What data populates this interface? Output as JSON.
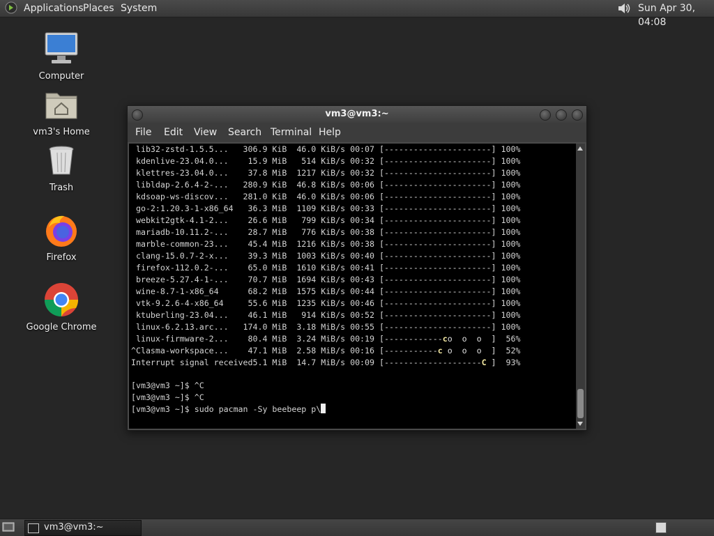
{
  "top_panel": {
    "menus": [
      "Applications",
      "Places",
      "System"
    ],
    "clock": "Sun Apr 30, 04:08",
    "icons": {
      "logo": "gnome-foot-icon",
      "volume": "speaker-icon"
    }
  },
  "desktop": {
    "icons": [
      {
        "label": "Computer",
        "icon": "computer-monitor-icon"
      },
      {
        "label": "vm3's Home",
        "icon": "home-folder-icon"
      },
      {
        "label": "Trash",
        "icon": "trash-can-icon"
      },
      {
        "label": "Firefox",
        "icon": "firefox-icon"
      },
      {
        "label": "Google Chrome",
        "icon": "chrome-icon"
      }
    ]
  },
  "terminal": {
    "title": "vm3@vm3:~",
    "menu": [
      "File",
      "Edit",
      "View",
      "Search",
      "Terminal",
      "Help"
    ],
    "lines": [
      " lib32-zstd-1.5.5...   306.9 KiB  46.0 KiB/s 00:07 [----------------------] 100%",
      " kdenlive-23.04.0...    15.9 MiB   514 KiB/s 00:32 [----------------------] 100%",
      " klettres-23.04.0...    37.8 MiB  1217 KiB/s 00:32 [----------------------] 100%",
      " libldap-2.6.4-2-...   280.9 KiB  46.8 KiB/s 00:06 [----------------------] 100%",
      " kdsoap-ws-discov...   281.0 KiB  46.0 KiB/s 00:06 [----------------------] 100%",
      " go-2:1.20.3-1-x86_64   36.3 MiB  1109 KiB/s 00:33 [----------------------] 100%",
      " webkit2gtk-4.1-2...    26.6 MiB   799 KiB/s 00:34 [----------------------] 100%",
      " mariadb-10.11.2-...    28.7 MiB   776 KiB/s 00:38 [----------------------] 100%",
      " marble-common-23...    45.4 MiB  1216 KiB/s 00:38 [----------------------] 100%",
      " clang-15.0.7-2-x...    39.3 MiB  1003 KiB/s 00:40 [----------------------] 100%",
      " firefox-112.0.2-...    65.0 MiB  1610 KiB/s 00:41 [----------------------] 100%",
      " breeze-5.27.4-1-...    70.7 MiB  1694 KiB/s 00:43 [----------------------] 100%",
      " wine-8.7-1-x86_64      68.2 MiB  1575 KiB/s 00:44 [----------------------] 100%",
      " vtk-9.2.6-4-x86_64     55.6 MiB  1235 KiB/s 00:46 [----------------------] 100%",
      " ktuberling-23.04...    46.1 MiB   914 KiB/s 00:52 [----------------------] 100%",
      " linux-6.2.13.arc...   174.0 MiB  3.18 MiB/s 00:55 [----------------------] 100%"
    ],
    "progress_lines": [
      {
        "pre": " linux-firmware-2...    80.4 MiB  3.24 MiB/s 00:19 [------------",
        "pac": "c",
        "pills": "o  o  o  ]",
        "pct": "  56%"
      },
      {
        "pre": "^Clasma-workspace...    47.1 MiB  2.58 MiB/s 00:16 [-----------",
        "pac": "c",
        "pills": " o  o  o  ]",
        "pct": "  52%"
      },
      {
        "pre": "Interrupt signal received5.1 MiB  14.7 MiB/s 00:09 [--------------------",
        "pac": "C",
        "pills": " ]",
        "pct": "  93%"
      }
    ],
    "prompt_lines": [
      "[vm3@vm3 ~]$ ^C",
      "[vm3@vm3 ~]$ ^C"
    ],
    "current_command": "[vm3@vm3 ~]$ sudo pacman -Sy beebeep p\\"
  },
  "bottom_panel": {
    "task_label": "vm3@vm3:~",
    "icons": {
      "show_desktop": "show-desktop-icon",
      "task": "terminal-icon",
      "workspace": "workspace-switcher-icon"
    }
  }
}
